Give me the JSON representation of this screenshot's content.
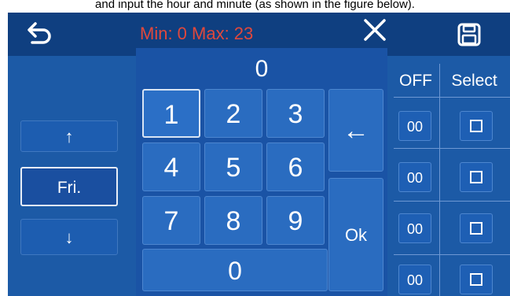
{
  "caption": "and input the hour and minute (as shown in the figure below).",
  "header": {
    "back_icon": "undo-arrow-icon",
    "range_text": "Min: 0  Max: 23",
    "close_icon": "close-icon",
    "save_icon": "save-disk-icon"
  },
  "day_selector": {
    "up_icon": "arrow-up-icon",
    "up_label": "↑",
    "value": "Fri.",
    "down_icon": "arrow-down-icon",
    "down_label": "↓"
  },
  "keypad": {
    "display_value": "0",
    "keys": [
      "1",
      "2",
      "3",
      "4",
      "5",
      "6",
      "7",
      "8",
      "9"
    ],
    "zero": "0",
    "backspace_label": "←",
    "ok_label": "Ok"
  },
  "table": {
    "headers": [
      "OFF",
      "Select"
    ],
    "rows": [
      {
        "off": "00",
        "select": false
      },
      {
        "off": "00",
        "select": false
      },
      {
        "off": "00",
        "select": false
      },
      {
        "off": "00",
        "select": false
      }
    ]
  },
  "colors": {
    "accent_red": "#e0483c",
    "panel_blue": "#1c5aa6",
    "topbar_blue": "#0f3f80"
  }
}
